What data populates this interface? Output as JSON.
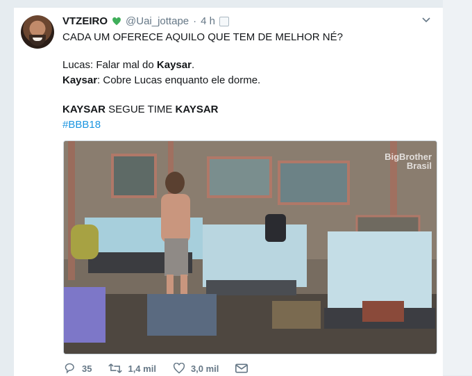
{
  "tweet": {
    "display_name": "VTZEIRO",
    "handle": "@Uai_jottape",
    "separator": "·",
    "time": "4 h",
    "lines": {
      "line1": "CADA UM OFERECE AQUILO QUE TEM DE MELHOR NÉ?",
      "line2_prefix": "Lucas: Falar mal do ",
      "line2_bold": "Kaysar",
      "line2_suffix": ".",
      "line3_bold": "Kaysar",
      "line3_rest": ": Cobre Lucas enquanto ele dorme.",
      "line4_bold1": "KAYSAR",
      "line4_mid": " SEGUE TIME ",
      "line4_bold2": "KAYSAR",
      "hashtag": "#BBB18"
    },
    "photo": {
      "watermark_line1": "BigBrother",
      "watermark_line2": "Brasil"
    },
    "actions": {
      "replies": "35",
      "retweets": "1,4 mil",
      "likes": "3,0 mil"
    }
  },
  "colors": {
    "accent": "#1b95e0",
    "verified_heart": "#3fae5a",
    "muted": "#657786"
  },
  "icons": [
    "heart-emoji-icon",
    "media-icon",
    "chevron-down-icon",
    "reply-icon",
    "retweet-icon",
    "like-icon",
    "message-icon"
  ]
}
